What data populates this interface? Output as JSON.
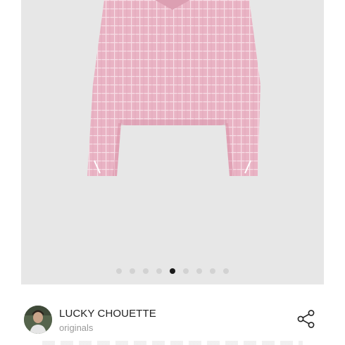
{
  "product": {
    "image_name": "pink tweed cropped jacket",
    "carousel": {
      "total": 9,
      "active_index": 4
    }
  },
  "seller": {
    "name": "LUCKY CHOUETTE",
    "subtitle": "originals",
    "avatar_icon": "avatar"
  },
  "actions": {
    "share_icon": "share-icon"
  },
  "colors": {
    "image_bg": "#e7e7e7",
    "fabric": "#eab6c6",
    "dot_inactive": "#d2d2d2",
    "dot_active": "#1a1a1a"
  }
}
